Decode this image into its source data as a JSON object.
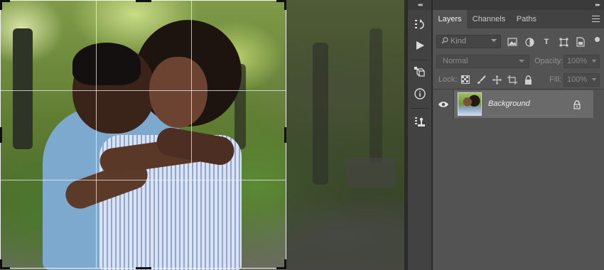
{
  "canvas": {
    "crop_grid": "rule-of-thirds"
  },
  "toolstrip": {
    "collapse": "◂◂",
    "buttons": [
      {
        "icon": "history-icon"
      },
      {
        "icon": "play-actions-icon"
      },
      {
        "icon": "3d-cube-icon"
      },
      {
        "icon": "info-icon"
      },
      {
        "icon": "clone-source-icon"
      }
    ]
  },
  "panel": {
    "collapse": "▸▸",
    "tabs": [
      {
        "label": "Layers",
        "active": true
      },
      {
        "label": "Channels",
        "active": false
      },
      {
        "label": "Paths",
        "active": false
      }
    ],
    "filter": {
      "kind_placeholder": "Kind",
      "icons": [
        "pixel-filter-icon",
        "adjustment-filter-icon",
        "type-filter-icon",
        "shape-filter-icon",
        "smart-object-filter-icon"
      ],
      "type_glyph": "T"
    },
    "blend": {
      "mode": "Normal",
      "opacity_label": "Opacity:",
      "opacity_value": "100%"
    },
    "lock": {
      "label": "Lock:",
      "icons": [
        "lock-transparent-icon",
        "lock-image-icon",
        "lock-position-icon",
        "lock-artboard-icon",
        "lock-all-icon"
      ],
      "fill_label": "Fill:",
      "fill_value": "100%"
    },
    "layers": [
      {
        "name": "Background",
        "visible": true,
        "locked": true
      }
    ]
  },
  "colors": {
    "panel_bg": "#535353",
    "selected_layer": "#6a6a6a",
    "app_bg": "#282828"
  }
}
